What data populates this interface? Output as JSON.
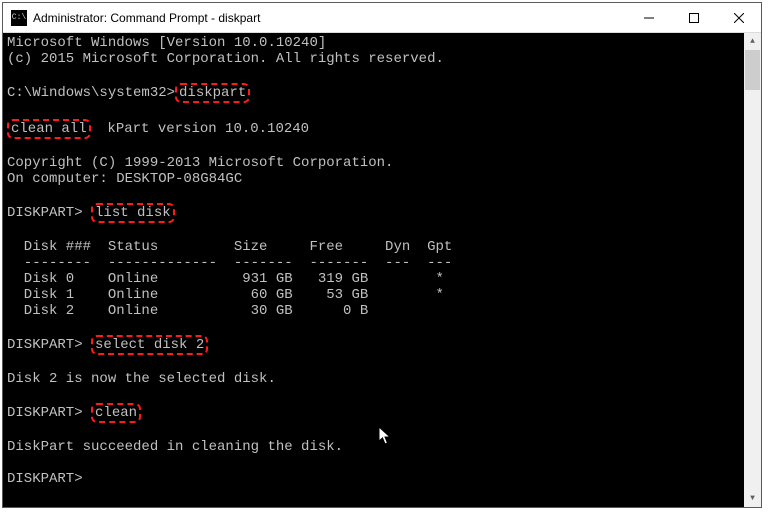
{
  "window": {
    "title": "Administrator: Command Prompt - diskpart",
    "icon_label": "C:\\"
  },
  "terminal": {
    "lines": {
      "l0": "Microsoft Windows [Version 10.0.10240]",
      "l1": "(c) 2015 Microsoft Corporation. All rights reserved.",
      "l2": "",
      "prompt1": "C:\\Windows\\system32>",
      "cmd1": "diskpart",
      "l4": "",
      "hl_clean_all": "clean all",
      "version_tail": "  kPart version 10.0.10240",
      "l6": "",
      "l7": "Copyright (C) 1999-2013 Microsoft Corporation.",
      "l8": "On computer: DESKTOP-08G84GC",
      "l9": "",
      "prompt2": "DISKPART> ",
      "cmd2": "list disk",
      "l11": "",
      "th": "  Disk ###  Status         Size     Free     Dyn  Gpt",
      "tdv": "  --------  -------------  -------  -------  ---  ---",
      "r0": "  Disk 0    Online          931 GB   319 GB        *",
      "r1": "  Disk 1    Online           60 GB    53 GB        *",
      "r2": "  Disk 2    Online           30 GB      0 B",
      "l17": "",
      "prompt3": "DISKPART> ",
      "cmd3": "select disk 2",
      "l19": "",
      "l20": "Disk 2 is now the selected disk.",
      "l21": "",
      "prompt4": "DISKPART> ",
      "cmd4": "clean",
      "l23": "",
      "l24": "DiskPart succeeded in cleaning the disk.",
      "l25": "",
      "prompt5": "DISKPART>"
    }
  }
}
